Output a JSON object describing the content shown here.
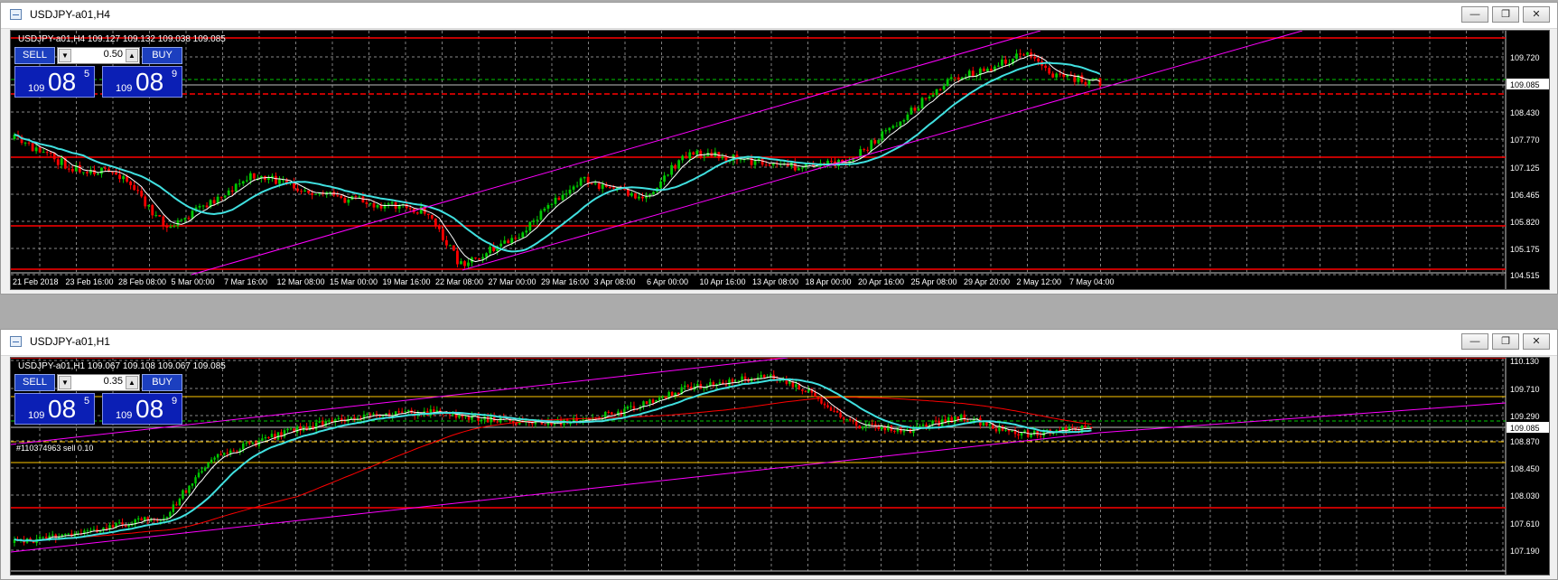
{
  "windows": [
    {
      "id": "h4",
      "title": "USDJPY-a01,H4",
      "symbol_line": "USDJPY-a01,H4  109.127 109.132 109.038 109.085",
      "trade_panel": {
        "sell_label": "SELL",
        "buy_label": "BUY",
        "lot": "0.50",
        "sell_price": {
          "prefix": "109",
          "big": "08",
          "sup": "5"
        },
        "buy_price": {
          "prefix": "109",
          "big": "08",
          "sup": "9"
        }
      },
      "price_axis": [
        "109.720",
        "109.085",
        "108.430",
        "107.770",
        "107.125",
        "106.465",
        "105.820",
        "105.175",
        "104.515"
      ],
      "current_price": "109.085",
      "time_axis": [
        "21 Feb 2018",
        "23 Feb 16:00",
        "28 Feb 08:00",
        "5 Mar 00:00",
        "7 Mar 16:00",
        "12 Mar 08:00",
        "15 Mar 00:00",
        "19 Mar 16:00",
        "22 Mar 08:00",
        "27 Mar 00:00",
        "29 Mar 16:00",
        "3 Apr 08:00",
        "6 Apr 00:00",
        "10 Apr 16:00",
        "13 Apr 08:00",
        "18 Apr 00:00",
        "20 Apr 16:00",
        "25 Apr 08:00",
        "29 Apr 20:00",
        "2 May 12:00",
        "7 May 04:00"
      ],
      "order_label": ""
    },
    {
      "id": "h1",
      "title": "USDJPY-a01,H1",
      "symbol_line": "USDJPY-a01,H1  109.067 109.108 109.067 109.085",
      "trade_panel": {
        "sell_label": "SELL",
        "buy_label": "BUY",
        "lot": "0.35",
        "sell_price": {
          "prefix": "109",
          "big": "08",
          "sup": "5"
        },
        "buy_price": {
          "prefix": "109",
          "big": "08",
          "sup": "9"
        }
      },
      "price_axis": [
        "110.130",
        "109.710",
        "109.290",
        "109.085",
        "108.870",
        "108.450",
        "108.030",
        "107.610",
        "107.190"
      ],
      "current_price": "109.085",
      "time_axis": [],
      "order_label": "#110374963 sell 0.10"
    }
  ],
  "window_controls": {
    "minimize": "—",
    "restore": "❐",
    "close": "✕"
  },
  "colors": {
    "background": "#000000",
    "grid": "#B4B4B4",
    "bull": "#00C800",
    "bear": "#FF0000",
    "ma_fast": "#FFFFFF",
    "ma_slow": "#40E0E0",
    "ma_long": "#FF0000",
    "channel": "#FF00FF",
    "level": "#FF0000",
    "order_level": "#FFC800",
    "bid_line": "#C0C0C0"
  },
  "icons": {
    "window_icon": "chart-window-icon",
    "lot_down": "arrow-down-icon",
    "lot_up": "arrow-up-icon"
  }
}
